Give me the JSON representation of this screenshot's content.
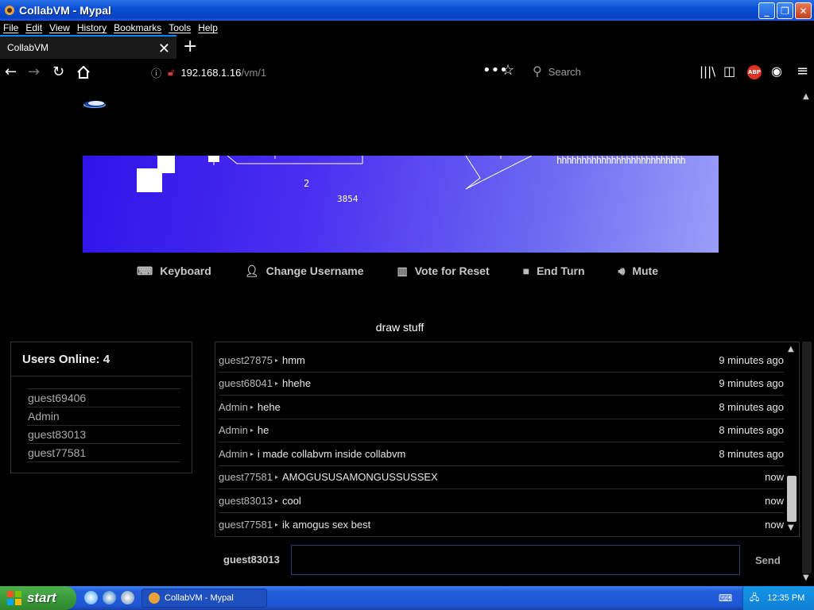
{
  "window": {
    "title": "CollabVM - Mypal"
  },
  "menubar": {
    "items": [
      "File",
      "Edit",
      "View",
      "History",
      "Bookmarks",
      "Tools",
      "Help"
    ]
  },
  "tab": {
    "title": "CollabVM"
  },
  "navbar": {
    "url_host": "192.168.1.16",
    "url_path": "/vm/1",
    "search_placeholder": "Search"
  },
  "vm": {
    "screen_texts": [
      "2",
      "3854",
      "hhhhhhhhhhhhhhhhhhhhhhhhhh"
    ],
    "toolbar": {
      "keyboard": "Keyboard",
      "change_username": "Change Username",
      "vote_reset": "Vote for Reset",
      "end_turn": "End Turn",
      "mute": "Mute"
    },
    "name": "draw stuff"
  },
  "users": {
    "header": "Users Online: 4",
    "list": [
      "guest69406",
      "Admin",
      "guest83013",
      "guest77581"
    ]
  },
  "chat": {
    "messages": [
      {
        "user": "guest27875",
        "text": "hmm",
        "time": "9 minutes ago"
      },
      {
        "user": "guest68041",
        "text": "hhehe",
        "time": "9 minutes ago"
      },
      {
        "user": "Admin",
        "text": "hehe",
        "time": "8 minutes ago"
      },
      {
        "user": "Admin",
        "text": "he",
        "time": "8 minutes ago"
      },
      {
        "user": "Admin",
        "text": "i made collabvm inside collabvm",
        "time": "8 minutes ago"
      },
      {
        "user": "guest77581",
        "text": "AMOGUSUSAMONGUSSUSSEX",
        "time": "now"
      },
      {
        "user": "guest83013",
        "text": "cool",
        "time": "now"
      },
      {
        "user": "guest77581",
        "text": "ik amogus sex best",
        "time": "now"
      }
    ],
    "username": "guest83013",
    "input_value": "",
    "send_label": "Send"
  },
  "taskbar": {
    "start_label": "start",
    "task_title": "CollabVM - Mypal",
    "clock": "12:35 PM"
  }
}
